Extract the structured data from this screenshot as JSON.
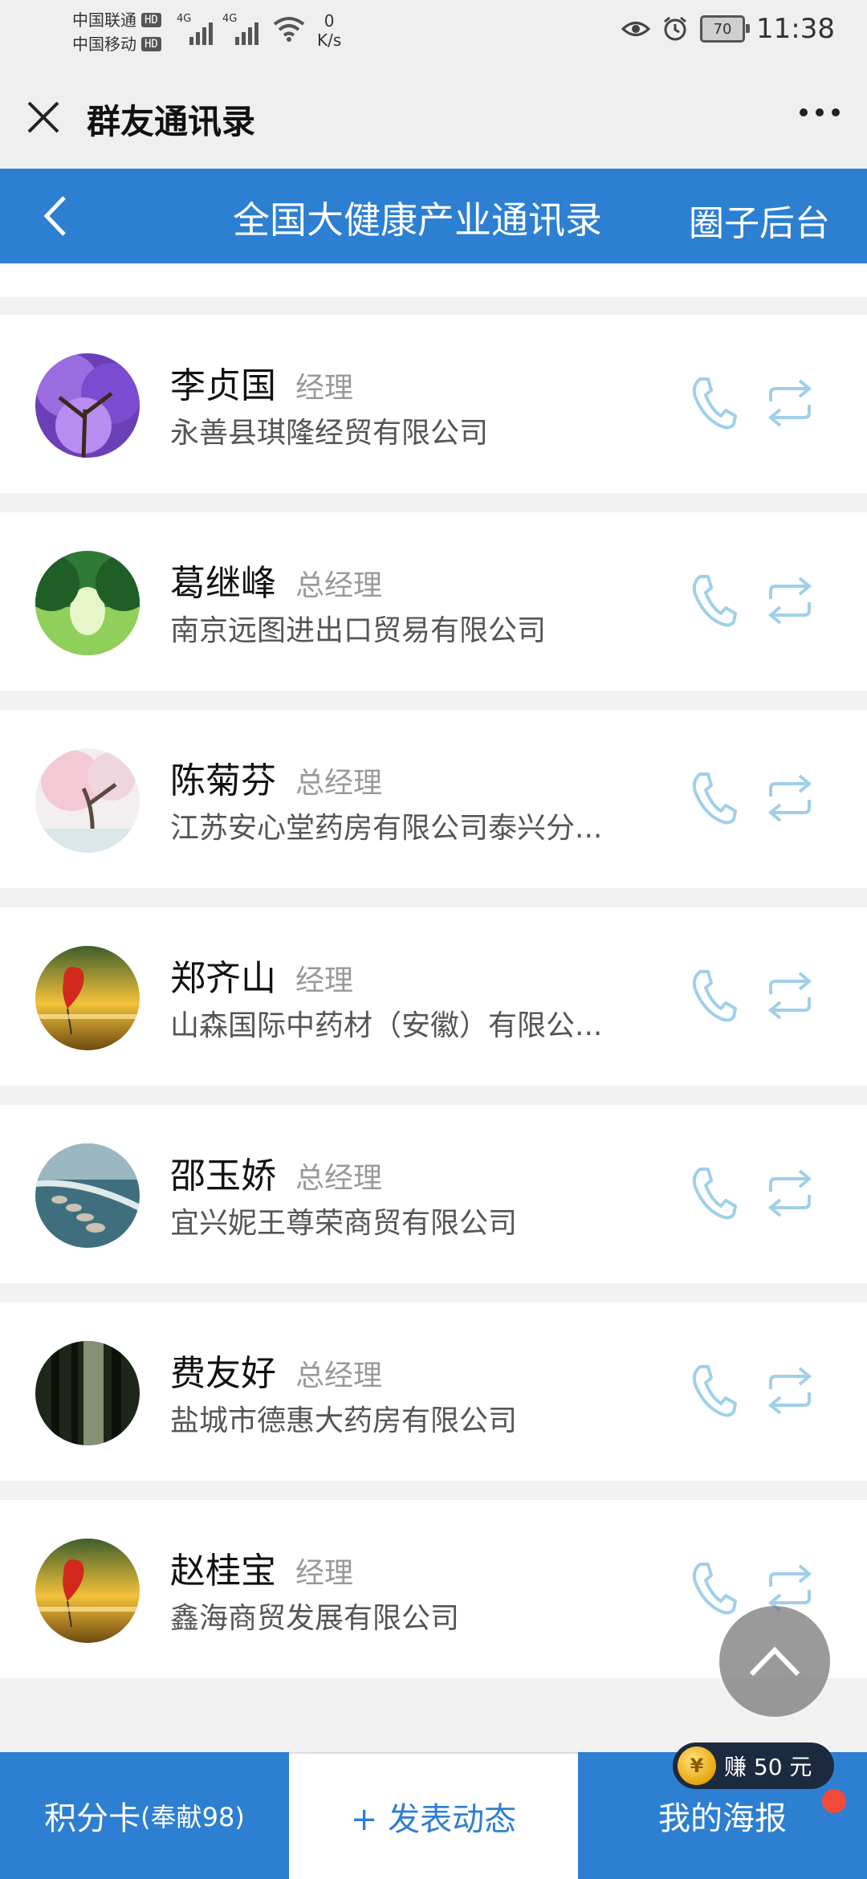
{
  "status_bar": {
    "carrier1": "中国联通",
    "carrier2": "中国移动",
    "hd": "HD",
    "net1": "4G",
    "net2": "4G",
    "speed_value": "0",
    "speed_unit": "K/s",
    "battery": "70",
    "time": "11:38"
  },
  "title_bar": {
    "title": "群友通讯录"
  },
  "header": {
    "title": "全国大健康产业通讯录",
    "right_link": "圈子后台"
  },
  "contacts": [
    {
      "name": "李贞国",
      "title": "经理",
      "company": "永善县琪隆经贸有限公司",
      "avatar": "purple-tree"
    },
    {
      "name": "葛继峰",
      "title": "总经理",
      "company": "南京远图进出口贸易有限公司",
      "avatar": "green-forest"
    },
    {
      "name": "陈菊芬",
      "title": "总经理",
      "company": "江苏安心堂药房有限公司泰兴分...",
      "avatar": "cherry-blossom"
    },
    {
      "name": "郑齐山",
      "title": "经理",
      "company": "山森国际中药材（安徽）有限公...",
      "avatar": "heart-sunset"
    },
    {
      "name": "邵玉娇",
      "title": "总经理",
      "company": "宜兴妮王尊荣商贸有限公司",
      "avatar": "stepping-stones"
    },
    {
      "name": "费友好",
      "title": "总经理",
      "company": "盐城市德惠大药房有限公司",
      "avatar": "dark-forest"
    },
    {
      "name": "赵桂宝",
      "title": "经理",
      "company": "鑫海商贸发展有限公司",
      "avatar": "heart-sunset"
    }
  ],
  "bottom_bar": {
    "points_label": "积分卡",
    "points_detail": "(奉献98)",
    "post_label": "+ 发表动态",
    "poster_label": "我的海报"
  },
  "earn_badge": {
    "coin": "¥",
    "text": "赚 50 元"
  },
  "colors": {
    "accent": "#2d7fd1",
    "icon": "#9fd0e8"
  }
}
